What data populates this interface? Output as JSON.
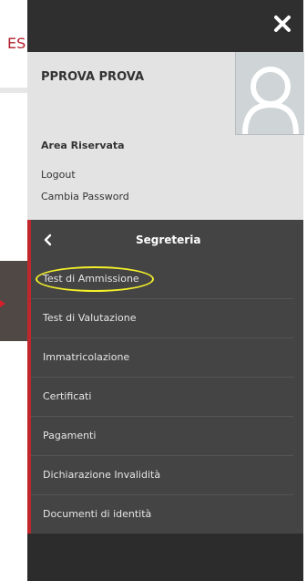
{
  "background": {
    "partial_text": "ES"
  },
  "drawer": {
    "close_icon": "close-icon",
    "user": {
      "name": "PPROVA PROVA",
      "avatar_icon": "user-avatar-icon"
    },
    "area_label": "Area Riservata",
    "links": {
      "logout": "Logout",
      "change_password": "Cambia Password"
    },
    "section": {
      "back_icon": "chevron-left-icon",
      "title": "Segreteria",
      "items": [
        {
          "label": "Test di Ammissione"
        },
        {
          "label": "Test di Valutazione"
        },
        {
          "label": "Immatricolazione"
        },
        {
          "label": "Certificati"
        },
        {
          "label": "Pagamenti"
        },
        {
          "label": "Dichiarazione Invalidità"
        },
        {
          "label": "Documenti di identità"
        }
      ]
    }
  },
  "colors": {
    "drawer_bg": "#2f2f2f",
    "section_bg": "#444444",
    "profile_bg": "#e3e3e3",
    "accent_red": "#c0272d",
    "highlight_yellow": "#f3ef2a"
  }
}
